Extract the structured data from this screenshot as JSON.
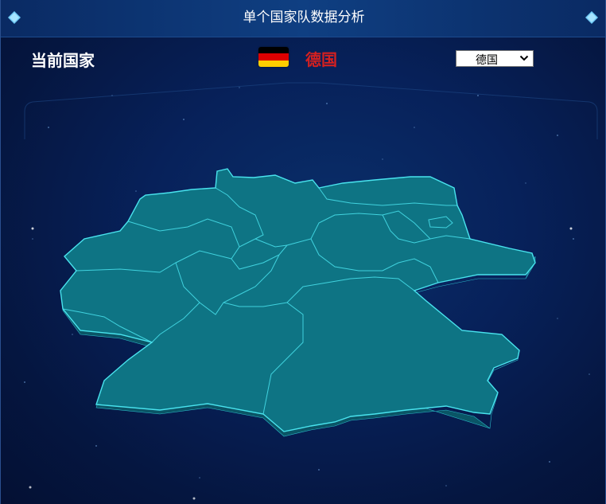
{
  "header": {
    "title": "单个国家队数据分析",
    "left_icon": "diamond-icon",
    "right_icon": "diamond-icon"
  },
  "country_bar": {
    "current_label": "当前国家",
    "flag_icon": "germany-flag-icon",
    "flag_colors": [
      "#000000",
      "#dd0000",
      "#ffce00"
    ],
    "country_name": "德国",
    "country_color": "#d42020",
    "select": {
      "selected": "德国"
    }
  },
  "map": {
    "country": "Germany",
    "fill_color": "#0e7484",
    "border_color": "#49e3ee",
    "side_color": "#0a5566"
  }
}
